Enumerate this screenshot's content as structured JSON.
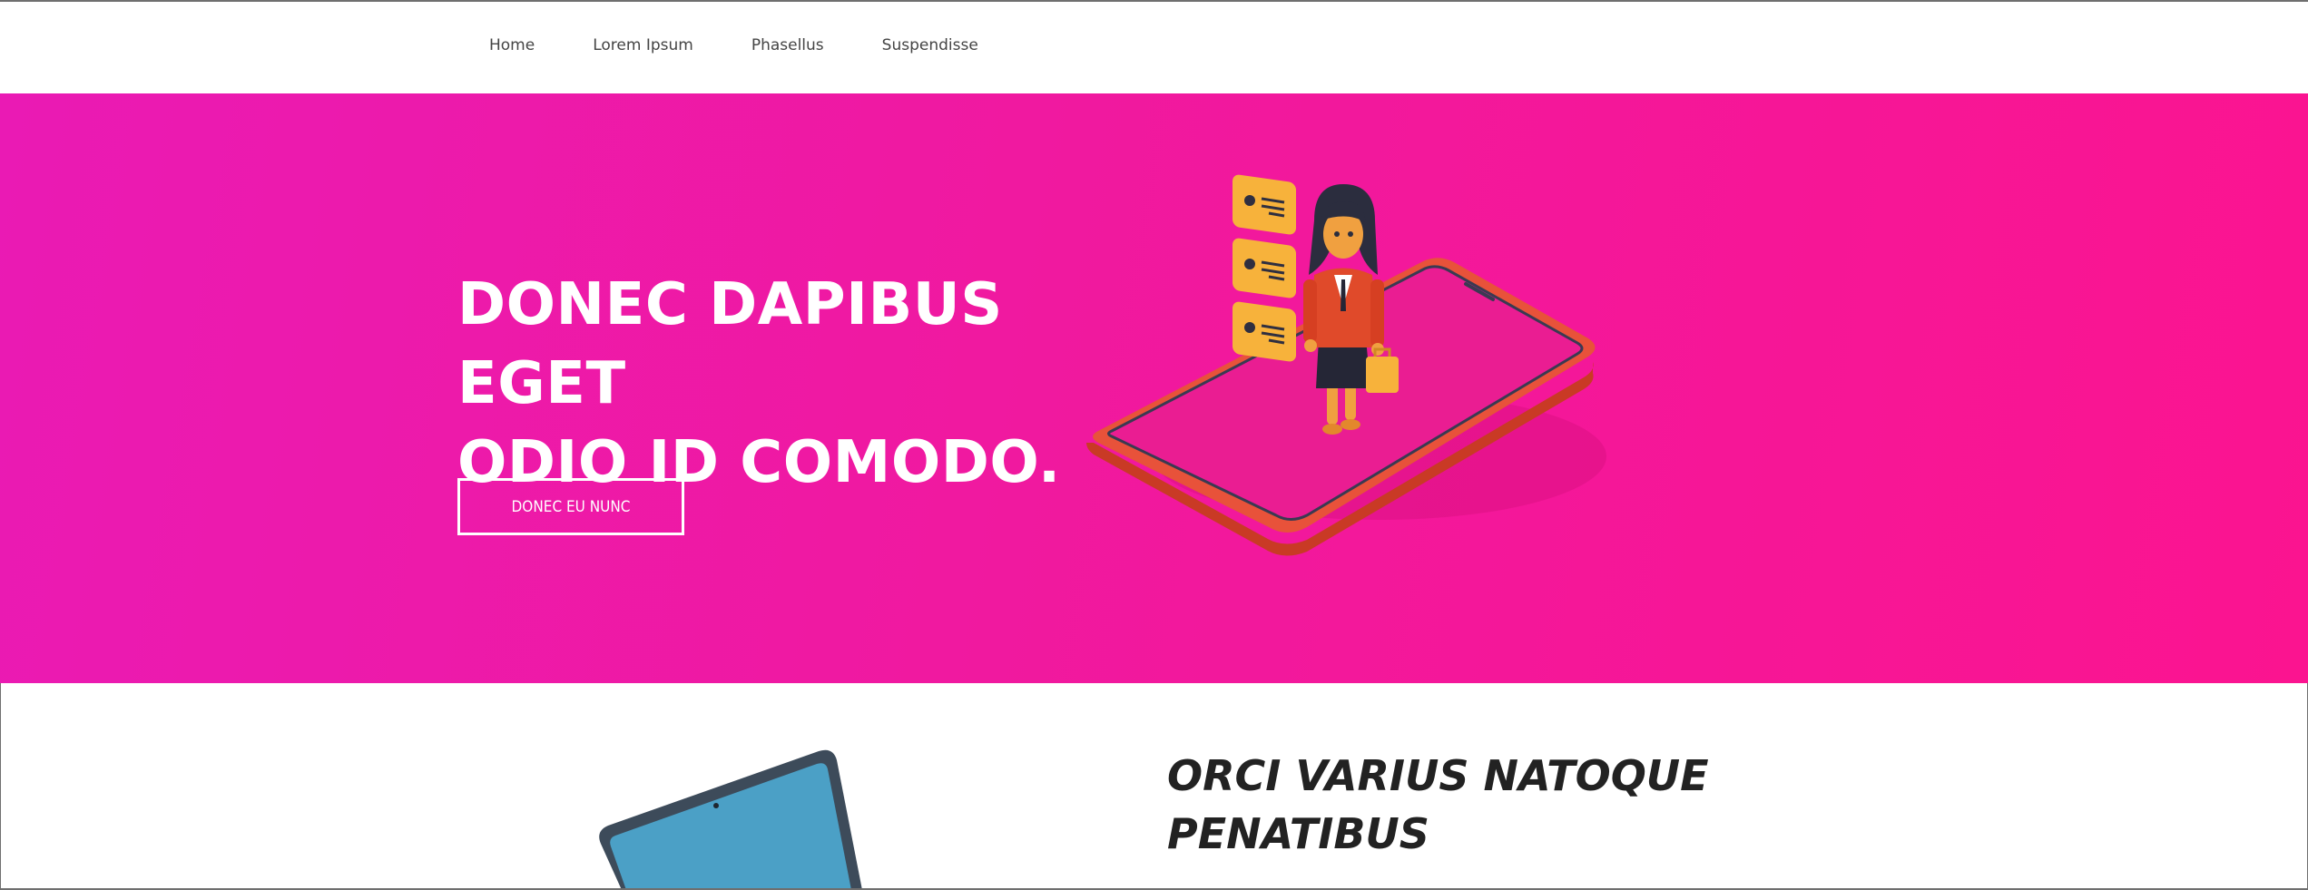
{
  "nav": {
    "items": [
      {
        "label": "Home"
      },
      {
        "label": "Lorem Ipsum"
      },
      {
        "label": "Phasellus"
      },
      {
        "label": "Suspendisse"
      }
    ]
  },
  "hero": {
    "title_line1": "DONEC DAPIBUS EGET",
    "title_line2": "ODIO ID COMODO.",
    "button_label": "DONEC EU NUNC",
    "background_color": "#f0199f",
    "illustration_icon": "businesswoman-on-phone-icon"
  },
  "feature": {
    "title_line1": "ORCI VARIUS NATOQUE",
    "title_line2": "PENATIBUS",
    "illustration_icon": "laptop-icon"
  }
}
